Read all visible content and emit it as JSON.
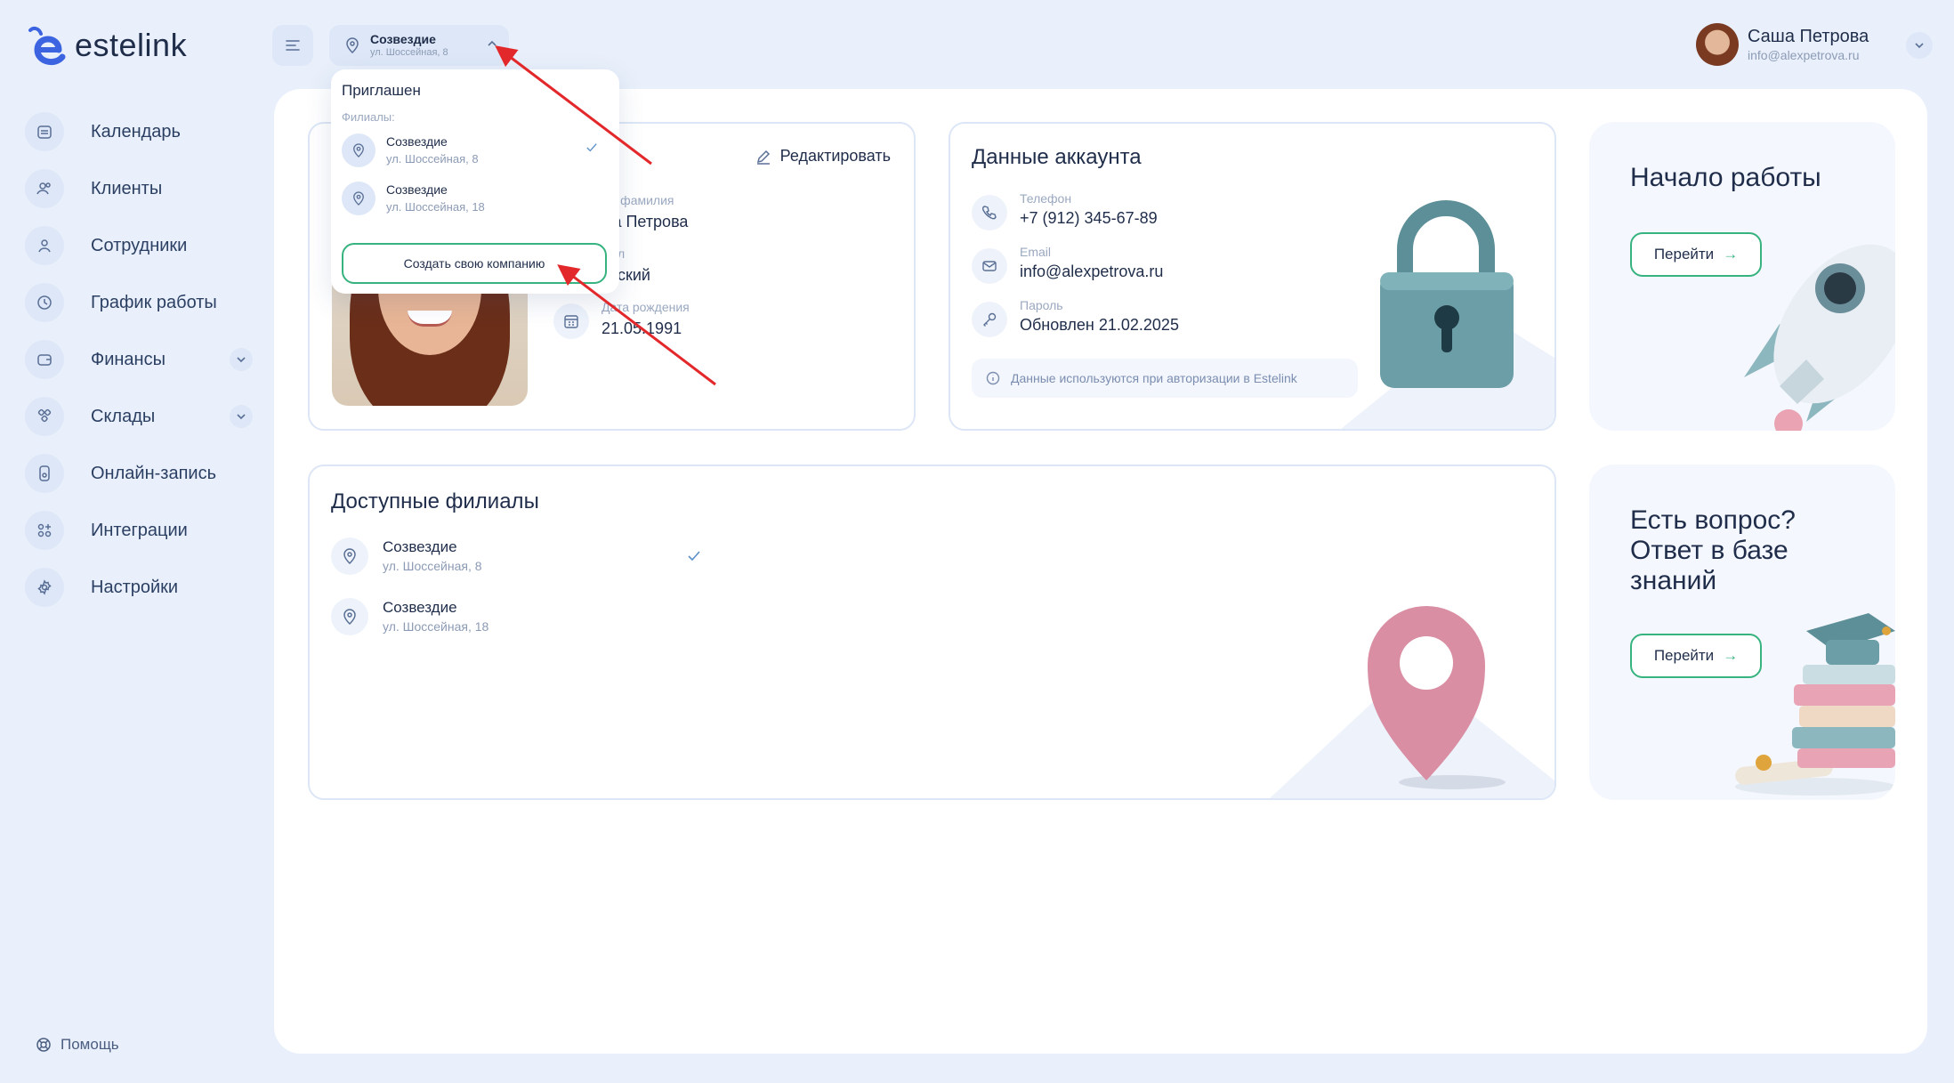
{
  "brand": {
    "name": "estelink"
  },
  "sidebar": {
    "items": [
      {
        "label": "Календарь"
      },
      {
        "label": "Клиенты"
      },
      {
        "label": "Сотрудники"
      },
      {
        "label": "График работы"
      },
      {
        "label": "Финансы"
      },
      {
        "label": "Склады"
      },
      {
        "label": "Онлайн-запись"
      },
      {
        "label": "Интеграции"
      },
      {
        "label": "Настройки"
      }
    ],
    "help": "Помощь"
  },
  "header": {
    "branch": {
      "name": "Созвездие",
      "address": "ул. Шоссейная, 8"
    },
    "user": {
      "name": "Саша Петрова",
      "email": "info@alexpetrova.ru"
    }
  },
  "dropdown": {
    "role": "Приглашен",
    "branches_label": "Филиалы:",
    "items": [
      {
        "name": "Созвездие",
        "address": "ул. Шоссейная, 8",
        "selected": true
      },
      {
        "name": "Созвездие",
        "address": "ул. Шоссейная, 18",
        "selected": false
      }
    ],
    "create_button": "Создать свою компанию"
  },
  "profile": {
    "edit_label": "Редактировать",
    "name_label": "я и фамилия",
    "name_value": "ша Петрова",
    "gender_label": "л",
    "gender_value": "енский",
    "birth_label": "Дата рождения",
    "birth_value": "21.05.1991"
  },
  "account": {
    "title": "Данные аккаунта",
    "phone_label": "Телефон",
    "phone_value": "+7 (912) 345-67-89",
    "email_label": "Email",
    "email_value": "info@alexpetrova.ru",
    "password_label": "Пароль",
    "password_value": "Обновлен 21.02.2025",
    "note": "Данные используются при авторизации в Estelink"
  },
  "promo_start": {
    "title": "Начало работы",
    "button": "Перейти"
  },
  "promo_help": {
    "title": "Есть вопрос? Ответ в базе знаний",
    "button": "Перейти"
  },
  "branches": {
    "title": "Доступные филиалы",
    "items": [
      {
        "name": "Созвездие",
        "address": "ул. Шоссейная, 8",
        "selected": true
      },
      {
        "name": "Созвездие",
        "address": "ул. Шоссейная, 18",
        "selected": false
      }
    ]
  },
  "colors": {
    "accent": "#36b37e",
    "background": "#e9f0fb",
    "icon_bg": "#dde7f7",
    "annotation": "#e3282b"
  }
}
